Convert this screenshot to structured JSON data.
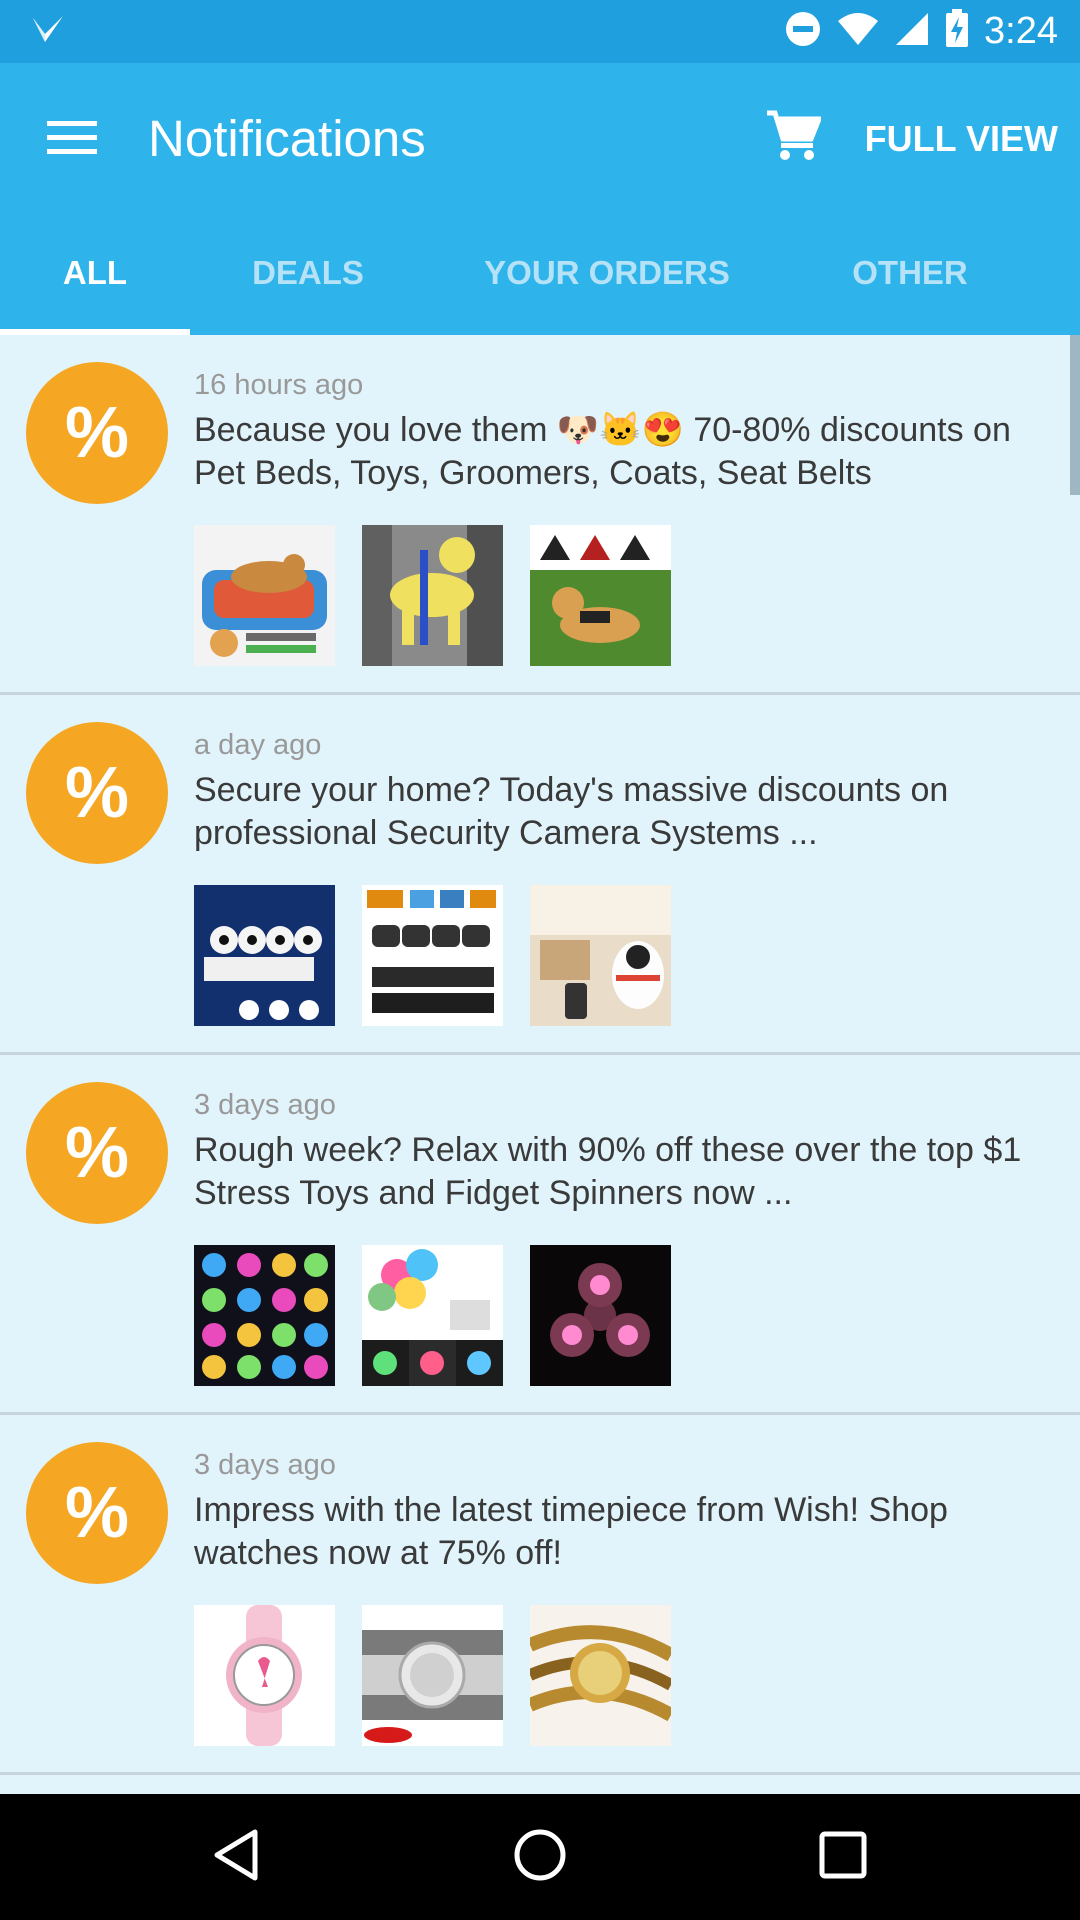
{
  "status_bar": {
    "time": "3:24",
    "icons": [
      "check-app-icon",
      "do-not-disturb-icon",
      "wifi-icon",
      "signal-icon",
      "battery-charging-icon"
    ]
  },
  "toolbar": {
    "menu_icon": "hamburger-menu-icon",
    "title": "Notifications",
    "cart_icon": "shopping-cart-icon",
    "full_view_label": "FULL VIEW"
  },
  "tabs": [
    {
      "label": "ALL",
      "active": true
    },
    {
      "label": "DEALS",
      "active": false
    },
    {
      "label": "YOUR ORDERS",
      "active": false
    },
    {
      "label": "OTHER",
      "active": false
    }
  ],
  "notifications": [
    {
      "badge": "%",
      "time": "16 hours ago",
      "message": "Because you love them 🐶🐱😍 70-80% discounts on Pet Beds, Toys, Groomers, Coats, Seat Belts",
      "thumbnails": [
        "pet-bed-image",
        "dog-seat-belt-image",
        "dog-harness-image"
      ]
    },
    {
      "badge": "%",
      "time": "a day ago",
      "message": "Secure your home? Today's massive discounts on professional Security Camera Systems ...",
      "thumbnails": [
        "wireless-camera-kit-image",
        "cctv-dvr-kit-image",
        "indoor-camera-image"
      ]
    },
    {
      "badge": "%",
      "time": "3 days ago",
      "message": "Rough week? Relax with 90% off these over the top $1 Stress Toys and Fidget Spinners now ...",
      "thumbnails": [
        "fidget-spinner-grid-image",
        "bluetooth-spinner-image",
        "led-spinner-image"
      ]
    },
    {
      "badge": "%",
      "time": "3 days ago",
      "message": "Impress with the latest timepiece from Wish! Shop watches now at 75% off!",
      "thumbnails": [
        "pink-watch-image",
        "crystal-watch-image",
        "gold-wrap-watch-image"
      ]
    }
  ],
  "nav_bar": {
    "icons": [
      "back-icon",
      "home-icon",
      "recents-icon"
    ]
  },
  "colors": {
    "status_bar": "#1f9fdd",
    "toolbar": "#2eb4eb",
    "list_background": "#e1f4fb",
    "badge": "#f5a623"
  }
}
